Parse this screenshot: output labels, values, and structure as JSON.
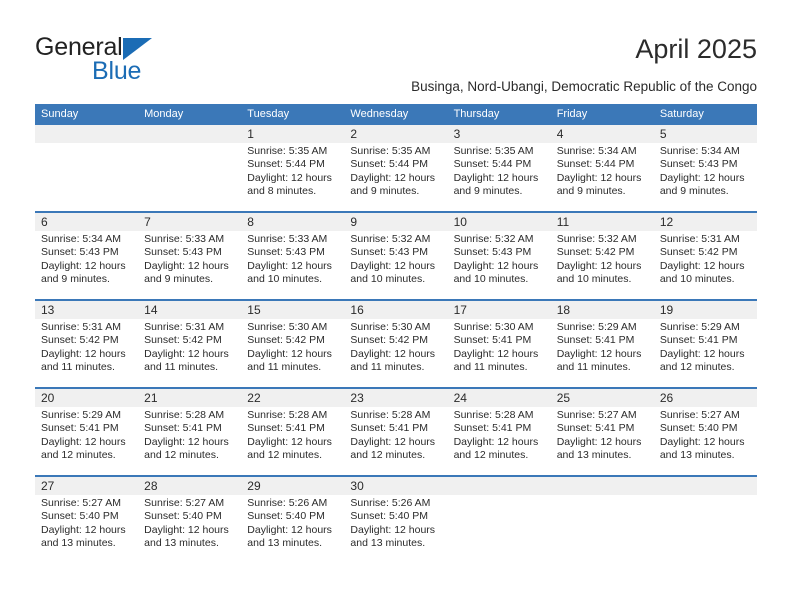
{
  "brand": {
    "name_top": "General",
    "name_bottom": "Blue",
    "triangle_icon": "triangle-icon",
    "accent_color": "#1b6cb5"
  },
  "header": {
    "title": "April 2025",
    "subtitle": "Businga, Nord-Ubangi, Democratic Republic of the Congo"
  },
  "colors": {
    "header_blue": "#3b78b8",
    "row_band_gray": "#f0f0f0",
    "text": "#2b2b2b"
  },
  "calendar": {
    "weekdays": [
      "Sunday",
      "Monday",
      "Tuesday",
      "Wednesday",
      "Thursday",
      "Friday",
      "Saturday"
    ],
    "weeks": [
      [
        {
          "day": "",
          "lines": []
        },
        {
          "day": "",
          "lines": []
        },
        {
          "day": "1",
          "lines": [
            "Sunrise: 5:35 AM",
            "Sunset: 5:44 PM",
            "Daylight: 12 hours",
            "and 8 minutes."
          ]
        },
        {
          "day": "2",
          "lines": [
            "Sunrise: 5:35 AM",
            "Sunset: 5:44 PM",
            "Daylight: 12 hours",
            "and 9 minutes."
          ]
        },
        {
          "day": "3",
          "lines": [
            "Sunrise: 5:35 AM",
            "Sunset: 5:44 PM",
            "Daylight: 12 hours",
            "and 9 minutes."
          ]
        },
        {
          "day": "4",
          "lines": [
            "Sunrise: 5:34 AM",
            "Sunset: 5:44 PM",
            "Daylight: 12 hours",
            "and 9 minutes."
          ]
        },
        {
          "day": "5",
          "lines": [
            "Sunrise: 5:34 AM",
            "Sunset: 5:43 PM",
            "Daylight: 12 hours",
            "and 9 minutes."
          ]
        }
      ],
      [
        {
          "day": "6",
          "lines": [
            "Sunrise: 5:34 AM",
            "Sunset: 5:43 PM",
            "Daylight: 12 hours",
            "and 9 minutes."
          ]
        },
        {
          "day": "7",
          "lines": [
            "Sunrise: 5:33 AM",
            "Sunset: 5:43 PM",
            "Daylight: 12 hours",
            "and 9 minutes."
          ]
        },
        {
          "day": "8",
          "lines": [
            "Sunrise: 5:33 AM",
            "Sunset: 5:43 PM",
            "Daylight: 12 hours",
            "and 10 minutes."
          ]
        },
        {
          "day": "9",
          "lines": [
            "Sunrise: 5:32 AM",
            "Sunset: 5:43 PM",
            "Daylight: 12 hours",
            "and 10 minutes."
          ]
        },
        {
          "day": "10",
          "lines": [
            "Sunrise: 5:32 AM",
            "Sunset: 5:43 PM",
            "Daylight: 12 hours",
            "and 10 minutes."
          ]
        },
        {
          "day": "11",
          "lines": [
            "Sunrise: 5:32 AM",
            "Sunset: 5:42 PM",
            "Daylight: 12 hours",
            "and 10 minutes."
          ]
        },
        {
          "day": "12",
          "lines": [
            "Sunrise: 5:31 AM",
            "Sunset: 5:42 PM",
            "Daylight: 12 hours",
            "and 10 minutes."
          ]
        }
      ],
      [
        {
          "day": "13",
          "lines": [
            "Sunrise: 5:31 AM",
            "Sunset: 5:42 PM",
            "Daylight: 12 hours",
            "and 11 minutes."
          ]
        },
        {
          "day": "14",
          "lines": [
            "Sunrise: 5:31 AM",
            "Sunset: 5:42 PM",
            "Daylight: 12 hours",
            "and 11 minutes."
          ]
        },
        {
          "day": "15",
          "lines": [
            "Sunrise: 5:30 AM",
            "Sunset: 5:42 PM",
            "Daylight: 12 hours",
            "and 11 minutes."
          ]
        },
        {
          "day": "16",
          "lines": [
            "Sunrise: 5:30 AM",
            "Sunset: 5:42 PM",
            "Daylight: 12 hours",
            "and 11 minutes."
          ]
        },
        {
          "day": "17",
          "lines": [
            "Sunrise: 5:30 AM",
            "Sunset: 5:41 PM",
            "Daylight: 12 hours",
            "and 11 minutes."
          ]
        },
        {
          "day": "18",
          "lines": [
            "Sunrise: 5:29 AM",
            "Sunset: 5:41 PM",
            "Daylight: 12 hours",
            "and 11 minutes."
          ]
        },
        {
          "day": "19",
          "lines": [
            "Sunrise: 5:29 AM",
            "Sunset: 5:41 PM",
            "Daylight: 12 hours",
            "and 12 minutes."
          ]
        }
      ],
      [
        {
          "day": "20",
          "lines": [
            "Sunrise: 5:29 AM",
            "Sunset: 5:41 PM",
            "Daylight: 12 hours",
            "and 12 minutes."
          ]
        },
        {
          "day": "21",
          "lines": [
            "Sunrise: 5:28 AM",
            "Sunset: 5:41 PM",
            "Daylight: 12 hours",
            "and 12 minutes."
          ]
        },
        {
          "day": "22",
          "lines": [
            "Sunrise: 5:28 AM",
            "Sunset: 5:41 PM",
            "Daylight: 12 hours",
            "and 12 minutes."
          ]
        },
        {
          "day": "23",
          "lines": [
            "Sunrise: 5:28 AM",
            "Sunset: 5:41 PM",
            "Daylight: 12 hours",
            "and 12 minutes."
          ]
        },
        {
          "day": "24",
          "lines": [
            "Sunrise: 5:28 AM",
            "Sunset: 5:41 PM",
            "Daylight: 12 hours",
            "and 12 minutes."
          ]
        },
        {
          "day": "25",
          "lines": [
            "Sunrise: 5:27 AM",
            "Sunset: 5:41 PM",
            "Daylight: 12 hours",
            "and 13 minutes."
          ]
        },
        {
          "day": "26",
          "lines": [
            "Sunrise: 5:27 AM",
            "Sunset: 5:40 PM",
            "Daylight: 12 hours",
            "and 13 minutes."
          ]
        }
      ],
      [
        {
          "day": "27",
          "lines": [
            "Sunrise: 5:27 AM",
            "Sunset: 5:40 PM",
            "Daylight: 12 hours",
            "and 13 minutes."
          ]
        },
        {
          "day": "28",
          "lines": [
            "Sunrise: 5:27 AM",
            "Sunset: 5:40 PM",
            "Daylight: 12 hours",
            "and 13 minutes."
          ]
        },
        {
          "day": "29",
          "lines": [
            "Sunrise: 5:26 AM",
            "Sunset: 5:40 PM",
            "Daylight: 12 hours",
            "and 13 minutes."
          ]
        },
        {
          "day": "30",
          "lines": [
            "Sunrise: 5:26 AM",
            "Sunset: 5:40 PM",
            "Daylight: 12 hours",
            "and 13 minutes."
          ]
        },
        {
          "day": "",
          "lines": []
        },
        {
          "day": "",
          "lines": []
        },
        {
          "day": "",
          "lines": []
        }
      ]
    ]
  }
}
